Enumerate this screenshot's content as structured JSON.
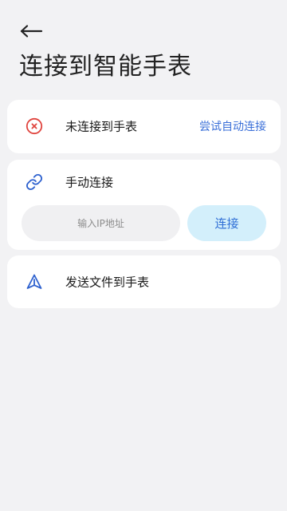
{
  "header": {
    "back_icon": "arrow-left-icon",
    "title": "连接到智能手表"
  },
  "status_card": {
    "icon": "error-circle-icon",
    "status_text": "未连接到手表",
    "auto_connect_label": "尝试自动连接"
  },
  "manual_card": {
    "icon": "link-icon",
    "title": "手动连接",
    "ip_input": {
      "value": "",
      "placeholder": "输入IP地址"
    },
    "connect_label": "连接"
  },
  "send_card": {
    "icon": "send-icon",
    "label": "发送文件到手表"
  },
  "colors": {
    "background": "#f2f2f4",
    "card": "#ffffff",
    "accent": "#3a6fd8",
    "error": "#e0443e",
    "button_bg": "#d3effb"
  }
}
